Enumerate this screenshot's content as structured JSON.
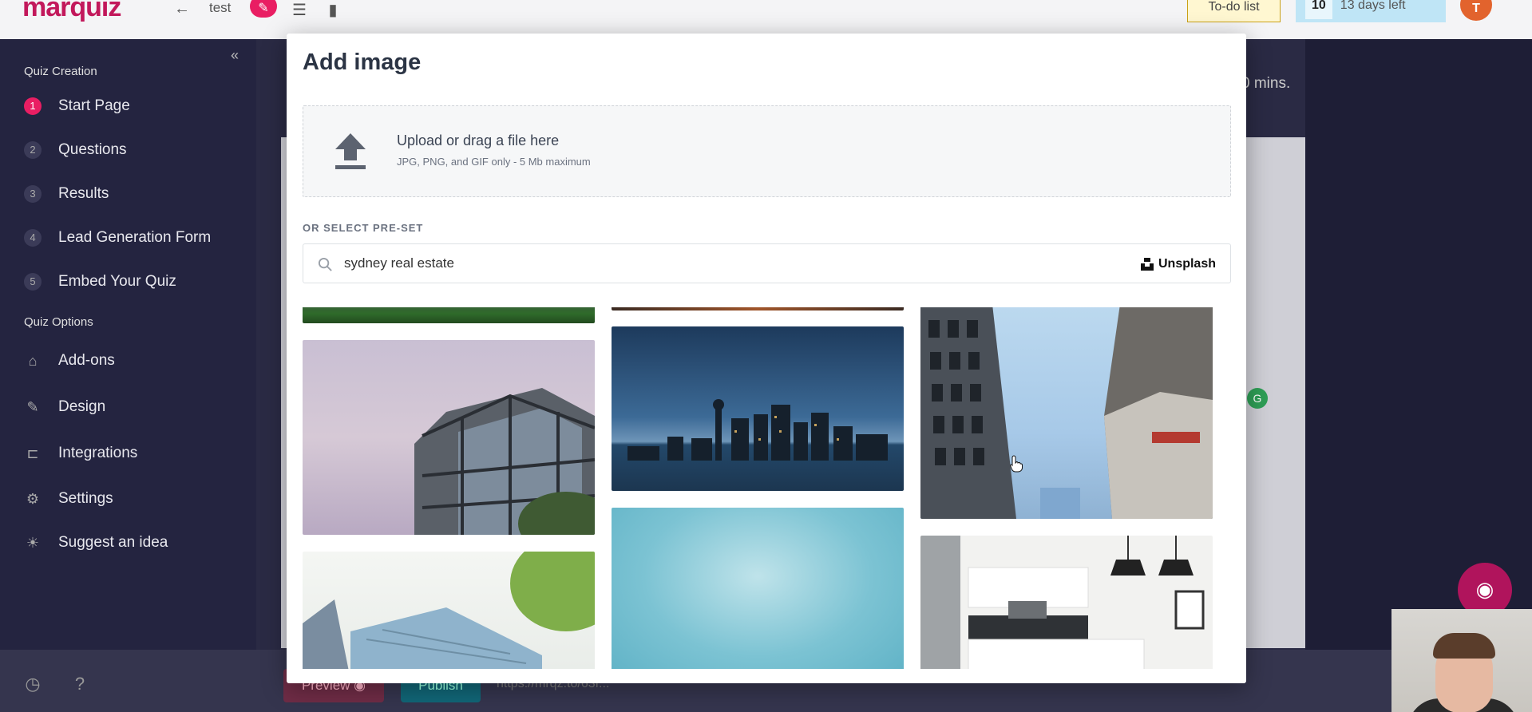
{
  "app": {
    "logo": "marquiz",
    "quiz_name": "test",
    "todo_label": "To-do list",
    "trial_days": "10",
    "trial_text": "13 days left",
    "avatar_letter": "T",
    "notice_text": "0 mins."
  },
  "sidebar": {
    "section_creation": "Quiz Creation",
    "creation_items": [
      {
        "num": "1",
        "label": "Start Page"
      },
      {
        "num": "2",
        "label": "Questions"
      },
      {
        "num": "3",
        "label": "Results"
      },
      {
        "num": "4",
        "label": "Lead Generation Form"
      },
      {
        "num": "5",
        "label": "Embed Your Quiz"
      }
    ],
    "section_options": "Quiz Options",
    "option_items": [
      {
        "icon": "tag-icon",
        "label": "Add-ons"
      },
      {
        "icon": "brush-icon",
        "label": "Design"
      },
      {
        "icon": "plug-icon",
        "label": "Integrations"
      },
      {
        "icon": "gear-icon",
        "label": "Settings"
      },
      {
        "icon": "lightbulb-icon",
        "label": "Suggest an idea"
      }
    ]
  },
  "bottom": {
    "preview_label": "Preview",
    "publish_label": "Publish",
    "url": "https://mrqz.to/63f..."
  },
  "modal": {
    "title": "Add image",
    "upload_title": "Upload or drag a file here",
    "upload_sub": "JPG, PNG, and GIF only - 5 Mb maximum",
    "preset_label": "OR SELECT PRE-SET",
    "search_value": "sydney real estate",
    "provider": "Unsplash"
  },
  "colors": {
    "accent": "#e91e63",
    "sidebar_bg": "#242440",
    "modal_title": "#2b3444"
  }
}
